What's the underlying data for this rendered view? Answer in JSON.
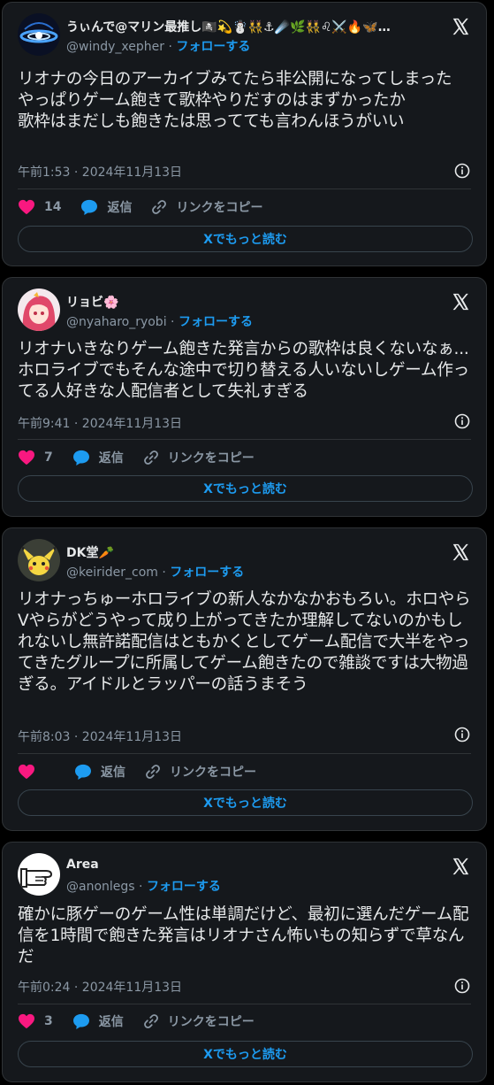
{
  "colors": {
    "background": "#000000",
    "card": "#15181c",
    "border": "#2f3336",
    "text": "#e7e9ea",
    "muted": "#8b98a5",
    "accent": "#1d9bf0",
    "like": "#f91880"
  },
  "common": {
    "follow_label": "フォローする",
    "reply_label": "返信",
    "copy_link_label": "リンクをコピー",
    "read_more_label": "Xでもっと読む",
    "separator": "·"
  },
  "tweets": [
    {
      "display_name": "うぃんで@マリン最推し🏴‍☠️💫☃️👯⚓☄️🌿👯♌⚔️🔥🦋…",
      "handle": "@windy_xepher",
      "text": "リオナの今日のアーカイブみてたら非公開になってしまった\nやっぱりゲーム飽きて歌枠やりだすのはまずかったか\n歌枠はまだしも飽きたは思ってても言わんほうがいい",
      "date": "午前1:53 · 2024年11月13日",
      "likes": "14",
      "avatar_icon": "galaxy-avatar-icon"
    },
    {
      "display_name": "リョビ🌸",
      "handle": "@nyaharo_ryobi",
      "text": "リオナいきなりゲーム飽きた発言からの歌枠は良くないなぁ...ホロライブでもそんな途中で切り替える人いないしゲーム作ってる人好きな人配信者として失礼すぎる",
      "date": "午前9:41 · 2024年11月13日",
      "likes": "7",
      "avatar_icon": "anime-girl-avatar-icon"
    },
    {
      "display_name": "DK堂🥕",
      "handle": "@keirider_com",
      "text": "リオナっちゅーホロライブの新人なかなかおもろい。ホロやらVやらがどうやって成り上がってきたか理解してないのかもしれないし無許諾配信はともかくとしてゲーム配信で大半をやってきたグループに所属してゲーム飽きたので雑談ですは大物過ぎる。アイドルとラッパーの話うまそう",
      "date": "午前8:03 · 2024年11月13日",
      "likes": "",
      "avatar_icon": "pichu-avatar-icon"
    },
    {
      "display_name": "Area",
      "handle": "@anonlegs",
      "text": "確かに豚ゲーのゲーム性は単調だけど、最初に選んだゲーム配信を1時間で飽きた発言はリオナさん怖いもの知らずで草なんだ",
      "date": "午前0:24 · 2024年11月13日",
      "likes": "3",
      "avatar_icon": "pointing-hand-avatar-icon"
    }
  ]
}
